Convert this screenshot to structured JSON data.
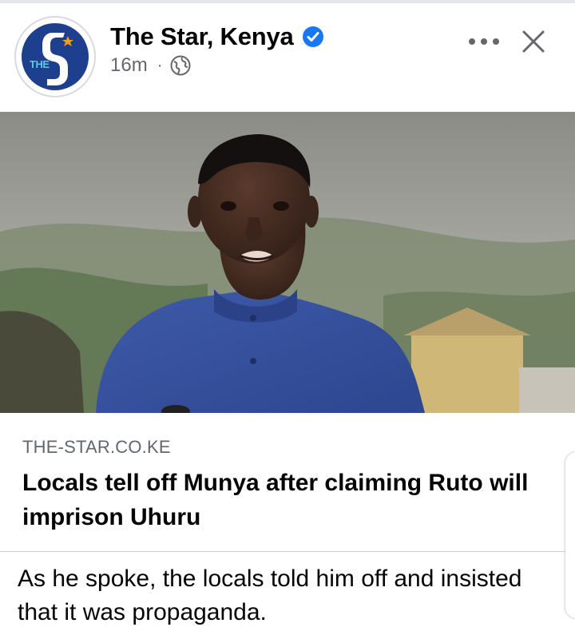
{
  "post": {
    "page_name": "The Star, Kenya",
    "time": "16m",
    "separator": "·",
    "avatar_text": "THE",
    "text": "As he spoke, the locals told him off and insisted that it was propaganda."
  },
  "link_preview": {
    "domain": "THE-STAR.CO.KE",
    "title": "Locals tell off Munya after claiming Ruto will imprison Uhuru"
  },
  "icons": {
    "verified": "verified-badge-icon",
    "audience": "globe-icon",
    "more": "more-options-icon",
    "close": "close-icon"
  },
  "colors": {
    "verified_blue": "#1877f2",
    "secondary_text": "#65676b",
    "brand_navy": "#1e3f8e"
  }
}
